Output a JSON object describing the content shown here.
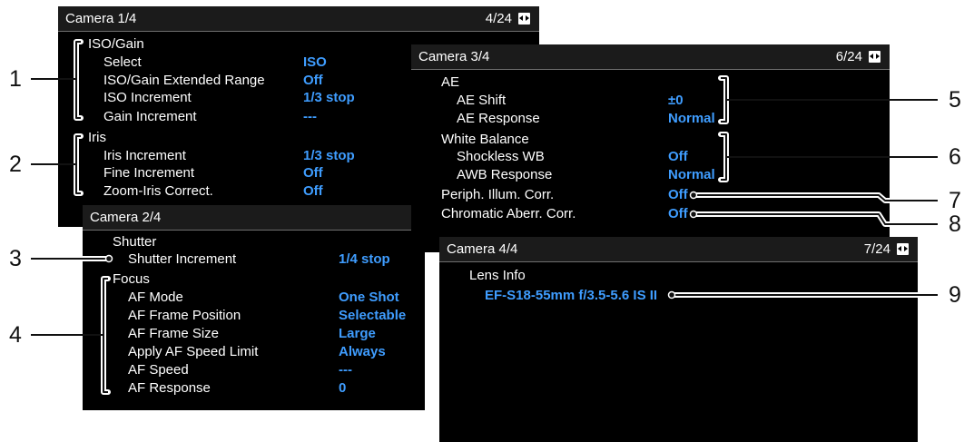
{
  "screens": {
    "cam1": {
      "title": "Camera 1/4",
      "page": "4/24",
      "group_iso": "ISO/Gain",
      "select": "Select",
      "select_val": "ISO",
      "iso_ext": "ISO/Gain Extended Range",
      "iso_ext_val": "Off",
      "iso_inc": "ISO Increment",
      "iso_inc_val": "1/3 stop",
      "gain_inc": "Gain Increment",
      "gain_inc_val": "---",
      "group_iris": "Iris",
      "iris_inc": "Iris Increment",
      "iris_inc_val": "1/3 stop",
      "fine_inc": "Fine Increment",
      "fine_inc_val": "Off",
      "zoom_iris": "Zoom-Iris Correct.",
      "zoom_iris_val": "Off"
    },
    "cam2": {
      "title": "Camera 2/4",
      "shutter": "Shutter",
      "shutter_inc": "Shutter Increment",
      "shutter_inc_val": "1/4 stop",
      "focus": "Focus",
      "af_mode": "AF Mode",
      "af_mode_val": "One Shot",
      "af_pos": "AF Frame Position",
      "af_pos_val": "Selectable",
      "af_size": "AF Frame Size",
      "af_size_val": "Large",
      "af_limit": "Apply AF Speed Limit",
      "af_limit_val": "Always",
      "af_speed": "AF Speed",
      "af_speed_val": "---",
      "af_resp": "AF Response",
      "af_resp_val": "0"
    },
    "cam3": {
      "title": "Camera 3/4",
      "page": "6/24",
      "ae": "AE",
      "ae_shift": "AE Shift",
      "ae_shift_val": "±0",
      "ae_resp": "AE Response",
      "ae_resp_val": "Normal",
      "wb": "White Balance",
      "shockless": "Shockless WB",
      "shockless_val": "Off",
      "awb_resp": "AWB Response",
      "awb_resp_val": "Normal",
      "periph": "Periph. Illum. Corr.",
      "periph_val": "Off",
      "chroma": "Chromatic Aberr. Corr.",
      "chroma_val": "Off"
    },
    "cam4": {
      "title": "Camera 4/4",
      "page": "7/24",
      "lens_info": "Lens Info",
      "lens_val": "EF-S18-55mm f/3.5-5.6 IS II"
    }
  },
  "callouts": [
    "1",
    "2",
    "3",
    "4",
    "5",
    "6",
    "7",
    "8",
    "9"
  ],
  "colors": {
    "value": "#3f9dff",
    "screen": "#000000",
    "header": "#1b1b1b"
  }
}
